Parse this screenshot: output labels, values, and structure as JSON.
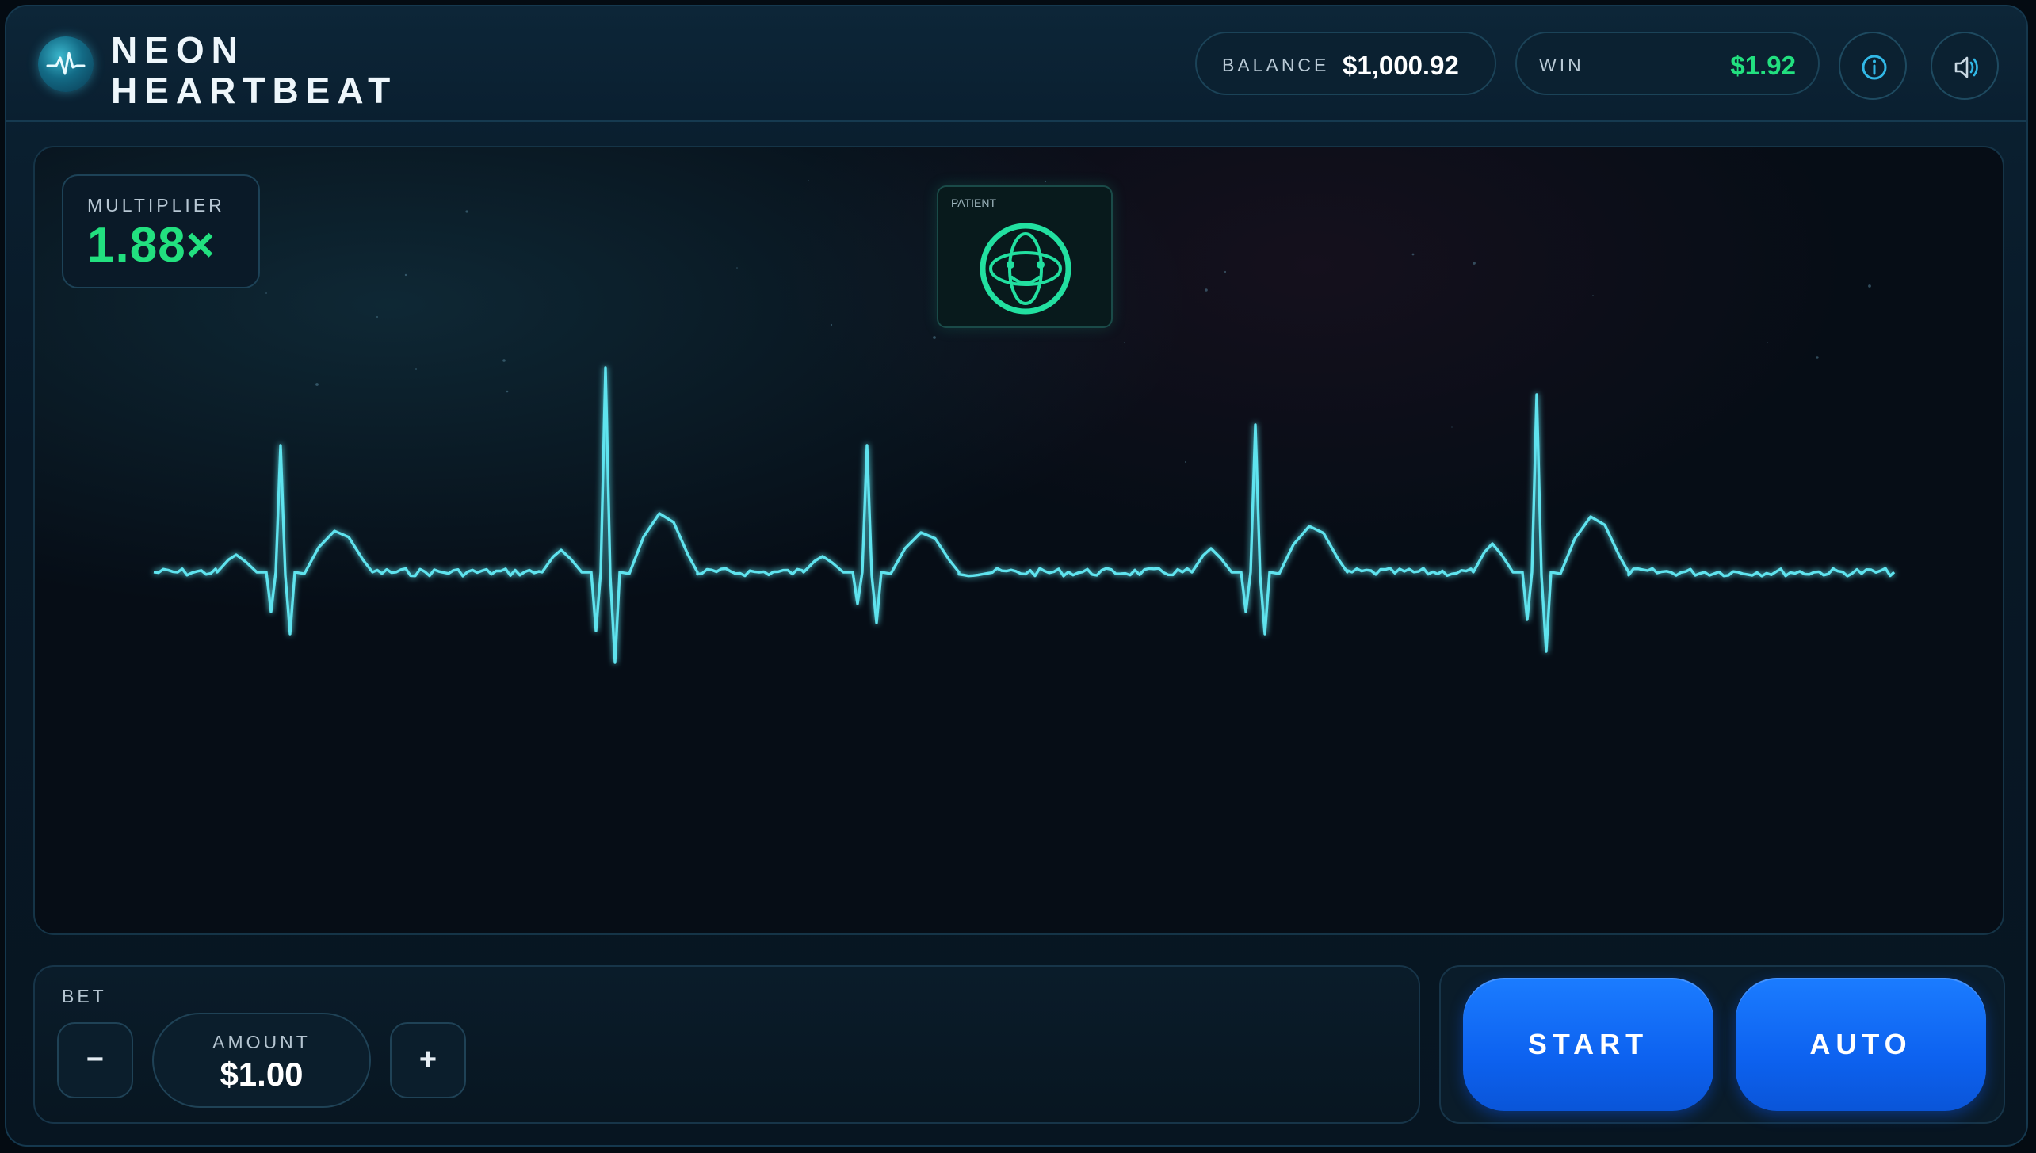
{
  "app": {
    "title_line1": "NEON",
    "title_line2": "HEARTBEAT",
    "logo_icon": "heartbeat-icon"
  },
  "header": {
    "balance_label": "BALANCE",
    "balance_value": "$1,000.92",
    "win_label": "WIN",
    "win_value": "$1.92",
    "info_icon": "info-icon",
    "sound_icon": "speaker-icon"
  },
  "game": {
    "multiplier_label": "MULTIPLIER",
    "multiplier_value": "1.88×",
    "patient_label": "PATIENT",
    "patient_icon": "patient-orb-icon"
  },
  "bet": {
    "label": "BET",
    "decrease_label": "−",
    "increase_label": "+",
    "amount_label": "AMOUNT",
    "amount_value": "$1.00"
  },
  "actions": {
    "start_label": "START",
    "auto_label": "AUTO"
  },
  "colors": {
    "accent_green": "#22e07f",
    "ecg_cyan": "#5fe3ee",
    "button_blue": "#0d62f0",
    "background": "#060d16"
  }
}
